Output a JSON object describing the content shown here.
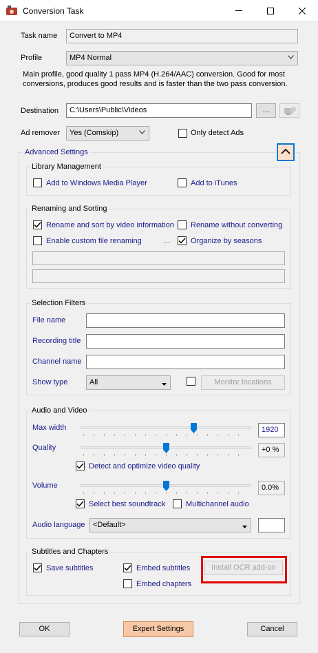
{
  "window": {
    "title": "Conversion Task",
    "minimize_icon": "minimize-icon",
    "maximize_icon": "maximize-icon",
    "close_icon": "close-icon"
  },
  "task": {
    "task_name_label": "Task name",
    "task_name_value": "Convert to MP4",
    "profile_label": "Profile",
    "profile_value": "MP4 Normal",
    "profile_description": "Main profile, good quality 1 pass MP4 (H.264/AAC) conversion. Good for most conversions, produces good results and is faster than the two pass conversion.",
    "destination_label": "Destination",
    "destination_value": "C:\\Users\\Public\\Videos",
    "browse_label": "...",
    "ad_remover_label": "Ad remover",
    "ad_remover_value": "Yes (Comskip)",
    "only_detect_ads_label": "Only detect Ads",
    "only_detect_ads_checked": false
  },
  "advanced": {
    "label": "Advanced Settings",
    "library": {
      "title": "Library Management",
      "add_wmp": {
        "label": "Add to Windows Media Player",
        "checked": false
      },
      "add_itunes": {
        "label": "Add to iTunes",
        "checked": false
      }
    },
    "renaming": {
      "title": "Renaming and Sorting",
      "rename_sort": {
        "label": "Rename and sort by video information",
        "checked": true
      },
      "rename_without_converting": {
        "label": "Rename without converting",
        "checked": false
      },
      "custom_renaming": {
        "label": "Enable custom file renaming",
        "checked": false
      },
      "custom_dots": "...",
      "organize_seasons": {
        "label": "Organize by seasons",
        "checked": true
      }
    },
    "filters": {
      "title": "Selection Filters",
      "file_name_label": "File name",
      "recording_title_label": "Recording title",
      "channel_name_label": "Channel name",
      "show_type_label": "Show type",
      "show_type_value": "All",
      "monitor_locations_label": "Monitor locations",
      "monitor_checked": false
    },
    "av": {
      "title": "Audio and Video",
      "max_width_label": "Max width",
      "max_width_value": "1920",
      "max_width_level": 0.67,
      "quality_label": "Quality",
      "quality_value": "+0 %",
      "quality_level": 0.5,
      "detect_optimize": {
        "label": "Detect and optimize video quality",
        "checked": true
      },
      "volume_label": "Volume",
      "volume_value": "0.0%",
      "volume_level": 0.5,
      "best_soundtrack": {
        "label": "Select best soundtrack",
        "checked": true
      },
      "multichannel": {
        "label": "Multichannel audio",
        "checked": false
      },
      "audio_language_label": "Audio language",
      "audio_language_value": "<Default>"
    },
    "subtitles": {
      "title": "Subtitles and Chapters",
      "save_subtitles": {
        "label": "Save subtitles",
        "checked": true
      },
      "embed_subtitles": {
        "label": "Embed subtitles",
        "checked": true
      },
      "embed_chapters": {
        "label": "Embed chapters",
        "checked": false
      },
      "install_ocr_label": "Install OCR add-on"
    }
  },
  "footer": {
    "ok_label": "OK",
    "expert_label": "Expert Settings",
    "cancel_label": "Cancel"
  },
  "colors": {
    "highlight": "#e00000",
    "accent": "#0078d7",
    "expert_button": "#f7c8a8"
  }
}
